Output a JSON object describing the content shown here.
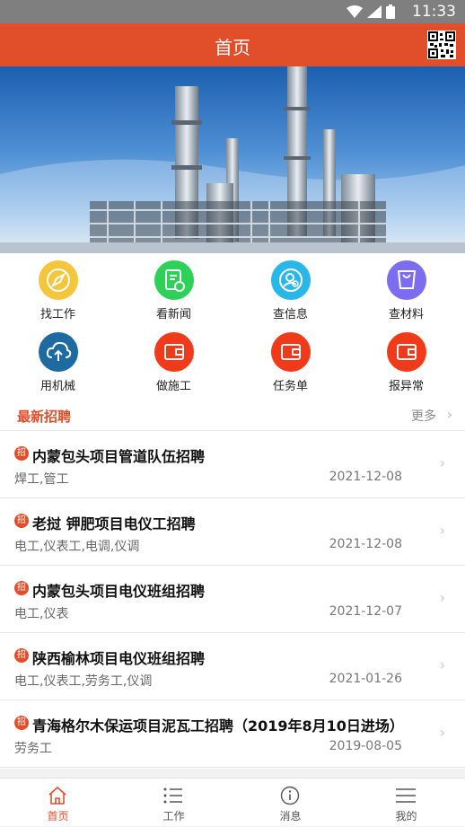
{
  "status_bar": {
    "time": "11:33"
  },
  "app_bar": {
    "title": "首页",
    "qr_icon": "qr-code-icon"
  },
  "menu": [
    {
      "label": "找工作",
      "icon": "compass-icon",
      "color": "#f5c63b"
    },
    {
      "label": "看新闻",
      "icon": "clipboard-clock-icon",
      "color": "#2ed158"
    },
    {
      "label": "查信息",
      "icon": "user-search-icon",
      "color": "#29b6e8"
    },
    {
      "label": "查材料",
      "icon": "shopping-bag-icon",
      "color": "#7b6cf0"
    },
    {
      "label": "用机械",
      "icon": "cloud-upload-icon",
      "color": "#1d6ba0"
    },
    {
      "label": "做施工",
      "icon": "wallet-icon",
      "color": "#f03a1a"
    },
    {
      "label": "任务单",
      "icon": "wallet-icon",
      "color": "#f03a1a"
    },
    {
      "label": "报异常",
      "icon": "wallet-icon",
      "color": "#f03a1a"
    }
  ],
  "recruit": {
    "title": "最新招聘",
    "more": "更多",
    "badge": "招",
    "items": [
      {
        "title": "内蒙包头项目管道队伍招聘",
        "tags": "焊工,管工",
        "date": "2021-12-08"
      },
      {
        "title": "老挝 钾肥项目电仪工招聘",
        "tags": "电工,仪表工,电调,仪调",
        "date": "2021-12-08"
      },
      {
        "title": "内蒙包头项目电仪班组招聘",
        "tags": "电工,仪表",
        "date": "2021-12-07"
      },
      {
        "title": "陕西榆林项目电仪班组招聘",
        "tags": "电工,仪表工,劳务工,仪调",
        "date": "2021-01-26"
      },
      {
        "title": "青海格尔木保运项目泥瓦工招聘（2019年8月10日进场）",
        "tags": "劳务工",
        "date": "2019-08-05"
      }
    ]
  },
  "tabs": [
    {
      "label": "首页",
      "icon": "home-icon"
    },
    {
      "label": "工作",
      "icon": "list-icon"
    },
    {
      "label": "消息",
      "icon": "info-icon"
    },
    {
      "label": "我的",
      "icon": "menu-icon"
    }
  ],
  "colors": {
    "accent": "#e14e2a"
  }
}
